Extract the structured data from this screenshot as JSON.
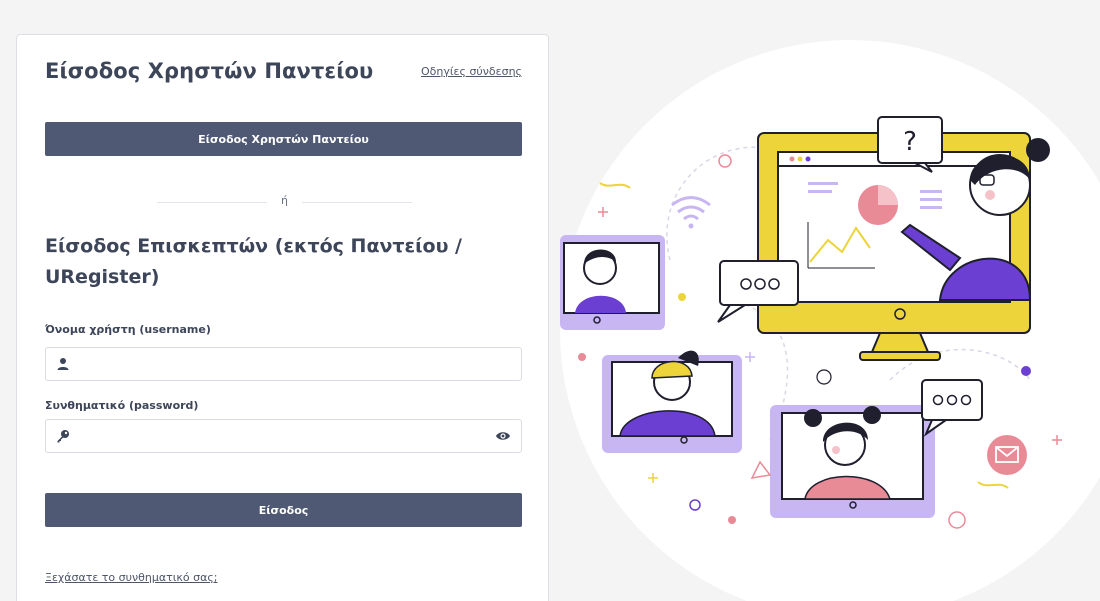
{
  "card": {
    "title": "Είσοδος Χρηστών Παντείου",
    "help_link": "Οδηγίες σύνδεσης",
    "sso_button": "Είσοδος Χρηστών Παντείου",
    "divider_text": "ή",
    "guest_title": "Είσοδος Επισκεπτών (εκτός Παντείου / URegister)",
    "username_label": "Όνομα χρήστη (username)",
    "username_value": "",
    "password_label": "Συνθηματικό (password)",
    "password_value": "",
    "login_button": "Είσοδος",
    "forgot_link": "Ξεχάσατε το συνθηματικό σας;"
  },
  "icons": {
    "username": "user-icon",
    "password": "key-icon",
    "toggle_password": "eye-icon"
  },
  "colors": {
    "button": "#4f5973",
    "text": "#3d4559",
    "accent_purple": "#6a3fd1",
    "accent_yellow": "#ecd43a",
    "accent_pink": "#e98a97",
    "accent_lilac": "#c7b6f2"
  }
}
